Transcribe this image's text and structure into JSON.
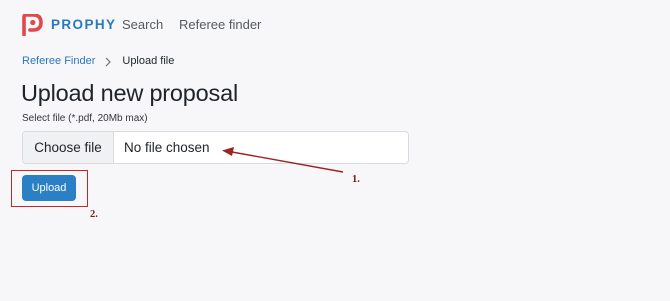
{
  "brand": {
    "name": "PROPHY",
    "color": "#2a78bf",
    "logo_icon": "prophy-logo-icon",
    "logo_color": "#e0484b"
  },
  "nav": {
    "search": "Search",
    "referee_finder": "Referee finder"
  },
  "breadcrumb": {
    "parent": "Referee Finder",
    "separator_icon": "chevron-right-icon",
    "current": "Upload file"
  },
  "page": {
    "title": "Upload new proposal"
  },
  "form": {
    "file_label": "Select file (*.pdf, 20Mb max)",
    "choose_button": "Choose file",
    "file_status": "No file chosen",
    "upload_button": "Upload",
    "upload_color": "#2a7fc5"
  },
  "annotations": {
    "arrow_label": "1.",
    "box_label": "2.",
    "color": "#c3272b"
  }
}
